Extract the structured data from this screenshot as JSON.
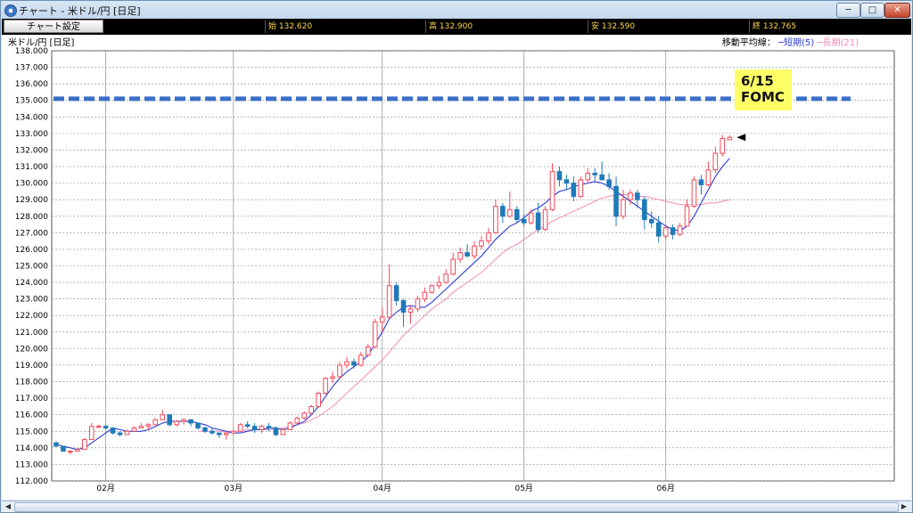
{
  "window": {
    "title": "チャート - 米ドル/円 [日足]",
    "minimize_label": "─",
    "maximize_label": "□",
    "close_label": "✕"
  },
  "toolbar": {
    "chart_settings_label": "チャート設定",
    "open_label": "始 132.620",
    "high_label": "高 132.900",
    "low_label": "安 132.590",
    "close_label": "終 132.765"
  },
  "header": {
    "instrument": "米ドル/円 [日足]",
    "ma_title": "移動平均線：",
    "ma_short": "─短期(5)",
    "ma_long": "─長期(21)"
  },
  "annotation": {
    "line1": "6/15",
    "line2": "FOMC"
  },
  "colors": {
    "up_candle": "#f04a5a",
    "down_candle": "#1f7ab8",
    "ma_short": "#2a3bd6",
    "ma_long": "#f08cb4",
    "reference_line": "#3a6fc7",
    "annotation_bg": "#ffff66"
  },
  "chart_data": {
    "type": "candlestick",
    "ylim": [
      112,
      138
    ],
    "yticks": [
      "138.000",
      "137.000",
      "136.000",
      "135.000",
      "134.000",
      "133.000",
      "132.000",
      "131.000",
      "130.000",
      "129.000",
      "128.000",
      "127.000",
      "126.000",
      "125.000",
      "124.000",
      "123.000",
      "122.000",
      "121.000",
      "120.000",
      "119.000",
      "118.000",
      "117.000",
      "116.000",
      "115.000",
      "114.000",
      "113.000",
      "112.000"
    ],
    "xticks": [
      {
        "label": "02月",
        "day": 7
      },
      {
        "label": "03月",
        "day": 25
      },
      {
        "label": "04月",
        "day": 46
      },
      {
        "label": "05月",
        "day": 66
      },
      {
        "label": "06月",
        "day": 86
      }
    ],
    "num_days": 108,
    "reference_level": 135.1,
    "last_close": 132.765,
    "candles": [
      [
        114.3,
        114.4,
        114.1,
        114.1
      ],
      [
        114.1,
        114.1,
        113.8,
        113.8
      ],
      [
        113.8,
        113.8,
        113.6,
        113.8
      ],
      [
        113.8,
        114.0,
        113.8,
        113.9
      ],
      [
        113.9,
        114.6,
        113.9,
        114.5
      ],
      [
        114.5,
        115.5,
        114.5,
        115.3
      ],
      [
        115.3,
        115.4,
        115.2,
        115.3
      ],
      [
        115.3,
        115.4,
        115.1,
        115.2
      ],
      [
        115.2,
        115.2,
        114.8,
        114.9
      ],
      [
        114.9,
        115.0,
        114.7,
        114.8
      ],
      [
        114.8,
        115.1,
        114.8,
        115.0
      ],
      [
        115.0,
        115.3,
        115.0,
        115.2
      ],
      [
        115.2,
        115.5,
        115.2,
        115.3
      ],
      [
        115.3,
        115.5,
        115.1,
        115.4
      ],
      [
        115.4,
        115.8,
        115.4,
        115.7
      ],
      [
        115.7,
        116.3,
        115.7,
        116.0
      ],
      [
        116.0,
        116.0,
        115.3,
        115.4
      ],
      [
        115.4,
        115.7,
        115.3,
        115.6
      ],
      [
        115.6,
        115.8,
        115.4,
        115.7
      ],
      [
        115.7,
        115.7,
        115.3,
        115.5
      ],
      [
        115.5,
        115.5,
        115.1,
        115.2
      ],
      [
        115.2,
        115.3,
        114.9,
        115.0
      ],
      [
        115.0,
        115.2,
        114.8,
        114.9
      ],
      [
        114.9,
        114.9,
        114.6,
        114.8
      ],
      [
        114.8,
        115.0,
        114.5,
        114.9
      ],
      [
        114.9,
        115.1,
        114.8,
        115.0
      ],
      [
        115.0,
        115.5,
        115.0,
        115.4
      ],
      [
        115.4,
        115.6,
        115.2,
        115.3
      ],
      [
        115.3,
        115.5,
        114.9,
        115.1
      ],
      [
        115.1,
        115.4,
        114.9,
        115.3
      ],
      [
        115.3,
        115.5,
        115.0,
        115.2
      ],
      [
        115.2,
        115.3,
        114.7,
        114.8
      ],
      [
        114.8,
        115.2,
        114.8,
        115.1
      ],
      [
        115.1,
        115.6,
        115.1,
        115.5
      ],
      [
        115.5,
        115.9,
        115.4,
        115.8
      ],
      [
        115.8,
        116.2,
        115.7,
        116.1
      ],
      [
        116.1,
        116.6,
        116.0,
        116.5
      ],
      [
        116.5,
        117.4,
        116.4,
        117.3
      ],
      [
        117.3,
        118.3,
        117.2,
        118.2
      ],
      [
        118.2,
        118.6,
        117.9,
        118.3
      ],
      [
        118.3,
        119.2,
        118.2,
        119.0
      ],
      [
        119.0,
        119.5,
        118.8,
        119.2
      ],
      [
        119.2,
        119.4,
        118.8,
        119.0
      ],
      [
        119.0,
        119.8,
        118.9,
        119.6
      ],
      [
        119.6,
        120.3,
        119.5,
        120.1
      ],
      [
        120.1,
        121.8,
        120.0,
        121.6
      ],
      [
        121.6,
        122.5,
        121.0,
        121.9
      ],
      [
        121.9,
        125.1,
        121.8,
        123.8
      ],
      [
        123.8,
        124.0,
        122.6,
        122.9
      ],
      [
        122.9,
        123.0,
        121.3,
        122.2
      ],
      [
        122.2,
        122.6,
        121.5,
        122.4
      ],
      [
        122.4,
        123.2,
        122.2,
        123.0
      ],
      [
        123.0,
        123.7,
        122.8,
        123.4
      ],
      [
        123.4,
        123.9,
        123.3,
        123.8
      ],
      [
        123.8,
        124.4,
        123.6,
        124.0
      ],
      [
        124.0,
        124.8,
        123.9,
        124.5
      ],
      [
        124.5,
        125.8,
        124.4,
        125.4
      ],
      [
        125.4,
        126.1,
        125.2,
        125.8
      ],
      [
        125.8,
        126.3,
        125.5,
        125.6
      ],
      [
        125.6,
        126.5,
        125.4,
        126.2
      ],
      [
        126.2,
        126.8,
        126.0,
        126.5
      ],
      [
        126.5,
        127.3,
        126.3,
        127.0
      ],
      [
        127.0,
        129.0,
        126.9,
        128.6
      ],
      [
        128.6,
        128.8,
        127.6,
        128.0
      ],
      [
        128.0,
        129.5,
        127.9,
        128.4
      ],
      [
        128.4,
        128.6,
        127.6,
        127.8
      ],
      [
        127.8,
        128.1,
        127.4,
        127.6
      ],
      [
        127.6,
        128.4,
        127.5,
        128.2
      ],
      [
        128.2,
        128.8,
        127.0,
        127.2
      ],
      [
        127.2,
        128.6,
        127.1,
        128.4
      ],
      [
        128.4,
        131.2,
        128.3,
        130.7
      ],
      [
        130.7,
        131.0,
        129.8,
        130.2
      ],
      [
        130.2,
        130.5,
        129.6,
        130.0
      ],
      [
        130.0,
        130.4,
        128.9,
        129.2
      ],
      [
        129.2,
        130.4,
        129.1,
        130.2
      ],
      [
        130.2,
        130.9,
        130.0,
        130.6
      ],
      [
        130.6,
        130.9,
        130.1,
        130.5
      ],
      [
        130.5,
        131.3,
        130.3,
        130.2
      ],
      [
        130.2,
        130.6,
        129.6,
        129.8
      ],
      [
        129.8,
        130.4,
        127.4,
        128.0
      ],
      [
        128.0,
        129.6,
        127.8,
        129.0
      ],
      [
        129.0,
        129.6,
        128.7,
        129.4
      ],
      [
        129.4,
        129.6,
        128.5,
        129.0
      ],
      [
        129.0,
        129.2,
        127.2,
        127.8
      ],
      [
        127.8,
        128.3,
        127.3,
        127.6
      ],
      [
        127.6,
        128.0,
        126.4,
        126.8
      ],
      [
        126.8,
        127.5,
        126.6,
        127.3
      ],
      [
        127.3,
        127.5,
        126.6,
        126.9
      ],
      [
        126.9,
        127.6,
        126.8,
        127.4
      ],
      [
        127.4,
        129.0,
        127.4,
        128.6
      ],
      [
        128.6,
        130.4,
        128.5,
        130.2
      ],
      [
        130.2,
        130.5,
        129.3,
        129.9
      ],
      [
        129.9,
        131.3,
        129.8,
        130.8
      ],
      [
        130.8,
        132.2,
        130.6,
        131.8
      ],
      [
        131.8,
        132.9,
        131.6,
        132.7
      ],
      [
        132.62,
        132.9,
        132.59,
        132.765
      ]
    ],
    "ma_short_values": [
      114.2,
      114.1,
      114.0,
      113.9,
      114.0,
      114.3,
      114.6,
      114.9,
      115.2,
      115.1,
      115.0,
      115.0,
      115.0,
      115.1,
      115.3,
      115.5,
      115.6,
      115.6,
      115.6,
      115.6,
      115.5,
      115.4,
      115.2,
      115.1,
      115.0,
      114.9,
      114.9,
      115.0,
      115.1,
      115.1,
      115.2,
      115.2,
      115.1,
      115.2,
      115.4,
      115.6,
      116.0,
      116.5,
      117.1,
      117.7,
      118.2,
      118.6,
      118.9,
      119.2,
      119.6,
      120.3,
      121.0,
      121.8,
      122.2,
      122.5,
      122.6,
      122.5,
      122.5,
      122.8,
      123.2,
      123.6,
      124.0,
      124.4,
      124.8,
      125.2,
      125.6,
      126.1,
      126.6,
      127.0,
      127.4,
      127.6,
      127.9,
      128.3,
      128.5,
      128.8,
      129.2,
      129.5,
      129.6,
      129.8,
      129.9,
      130.0,
      130.1,
      130.0,
      129.8,
      129.5,
      129.2,
      128.9,
      128.6,
      128.3,
      128.0,
      127.7,
      127.4,
      127.2,
      127.1,
      127.4,
      128.0,
      128.8,
      129.6,
      130.4,
      131.0,
      131.5
    ],
    "ma_long_values": [
      null,
      null,
      null,
      null,
      null,
      null,
      null,
      null,
      null,
      null,
      null,
      null,
      null,
      null,
      null,
      null,
      null,
      null,
      null,
      null,
      115.0,
      115.0,
      115.0,
      115.0,
      115.0,
      115.0,
      115.0,
      115.1,
      115.1,
      115.1,
      115.1,
      115.1,
      115.2,
      115.3,
      115.4,
      115.5,
      115.7,
      115.9,
      116.2,
      116.5,
      116.9,
      117.3,
      117.7,
      118.1,
      118.5,
      118.9,
      119.3,
      119.8,
      120.3,
      120.8,
      121.2,
      121.6,
      122.0,
      122.4,
      122.7,
      123.0,
      123.4,
      123.7,
      124.0,
      124.3,
      124.6,
      125.0,
      125.4,
      125.8,
      126.1,
      126.3,
      126.6,
      126.9,
      127.2,
      127.4,
      127.7,
      127.9,
      128.1,
      128.3,
      128.5,
      128.7,
      128.9,
      129.1,
      129.2,
      129.3,
      129.3,
      129.3,
      129.2,
      129.2,
      129.1,
      129.0,
      128.9,
      128.8,
      128.7,
      128.7,
      128.7,
      128.7,
      128.8,
      128.8,
      128.9,
      129.0
    ]
  }
}
